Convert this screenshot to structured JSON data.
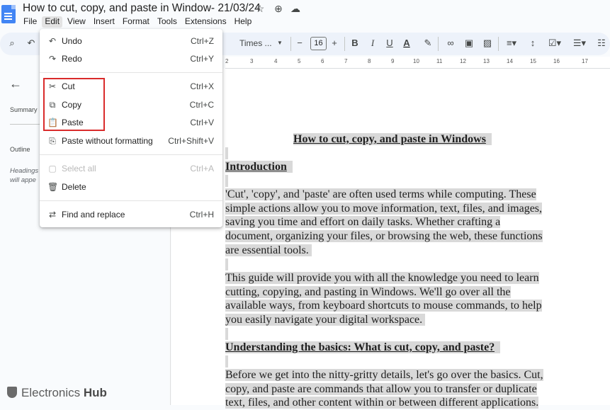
{
  "doc": {
    "title": "How to cut, copy, and paste in Window- 21/03/24"
  },
  "menubar": [
    "File",
    "Edit",
    "View",
    "Insert",
    "Format",
    "Tools",
    "Extensions",
    "Help"
  ],
  "toolbar": {
    "font": "Times ...",
    "font_size": "16"
  },
  "ruler_numbers": [
    "2",
    "3",
    "4",
    "5",
    "6",
    "7",
    "8",
    "9",
    "10",
    "11",
    "12",
    "13",
    "14",
    "15",
    "16",
    "17"
  ],
  "left_panel": {
    "summary": "Summary",
    "outline": "Outline",
    "headings_hint_1": "Headings",
    "headings_hint_2": "will appe"
  },
  "edit_menu": {
    "undo": {
      "label": "Undo",
      "shortcut": "Ctrl+Z"
    },
    "redo": {
      "label": "Redo",
      "shortcut": "Ctrl+Y"
    },
    "cut": {
      "label": "Cut",
      "shortcut": "Ctrl+X"
    },
    "copy": {
      "label": "Copy",
      "shortcut": "Ctrl+C"
    },
    "paste": {
      "label": "Paste",
      "shortcut": "Ctrl+V"
    },
    "paste_plain": {
      "label": "Paste without formatting",
      "shortcut": "Ctrl+Shift+V"
    },
    "select_all": {
      "label": "Select all",
      "shortcut": "Ctrl+A"
    },
    "delete": {
      "label": "Delete",
      "shortcut": ""
    },
    "find_replace": {
      "label": "Find and replace",
      "shortcut": "Ctrl+H"
    }
  },
  "document": {
    "title": "How to cut, copy, and paste in Windows",
    "h_intro": "Introduction",
    "p1": [
      "'Cut', 'copy', and 'paste' are often used terms while computing. These",
      "simple actions allow you to move information, text, files, and images,",
      "saving you time and effort on daily tasks. Whether crafting a",
      "document, organizing your files, or browsing the web, these functions",
      "are essential tools."
    ],
    "p2": [
      "This guide will provide you with all the knowledge you need to learn",
      "cutting, copying, and pasting in Windows. We'll go over all the",
      "available ways, from keyboard shortcuts to mouse commands, to help",
      "you easily navigate your digital workspace."
    ],
    "h_basics": "Understanding the basics: What is cut, copy, and paste?",
    "p3": [
      "Before we get into the nitty-gritty details, let's go over the basics. Cut,",
      "copy, and paste are commands that allow you to transfer or duplicate",
      "text, files, and other content within or between different applications."
    ]
  },
  "watermark": {
    "brand_a": "Electronics ",
    "brand_b": "Hub"
  },
  "colors": {
    "highlight": "#d9d9d9",
    "annotation_red": "#d92b2b",
    "docs_blue": "#4285f4"
  }
}
